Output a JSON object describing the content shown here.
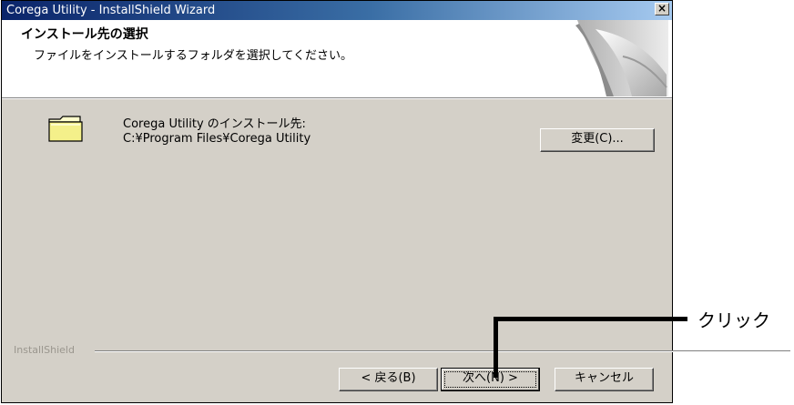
{
  "window": {
    "title": "Corega Utility - InstallShield Wizard",
    "close_symbol": "×"
  },
  "header": {
    "title": "インストール先の選択",
    "subtitle": "ファイルをインストールするフォルダを選択してください。"
  },
  "body": {
    "folder_icon": "folder-icon",
    "install_label": "Corega Utility のインストール先:",
    "install_path": "C:¥Program Files¥Corega Utility",
    "change_button": "変更(C)..."
  },
  "footer": {
    "brand": "InstallShield",
    "back_button": "< 戻る(B)",
    "next_button": "次へ(N) >",
    "cancel_button": "キャンセル"
  },
  "annotation": {
    "callout_text": "クリック"
  }
}
